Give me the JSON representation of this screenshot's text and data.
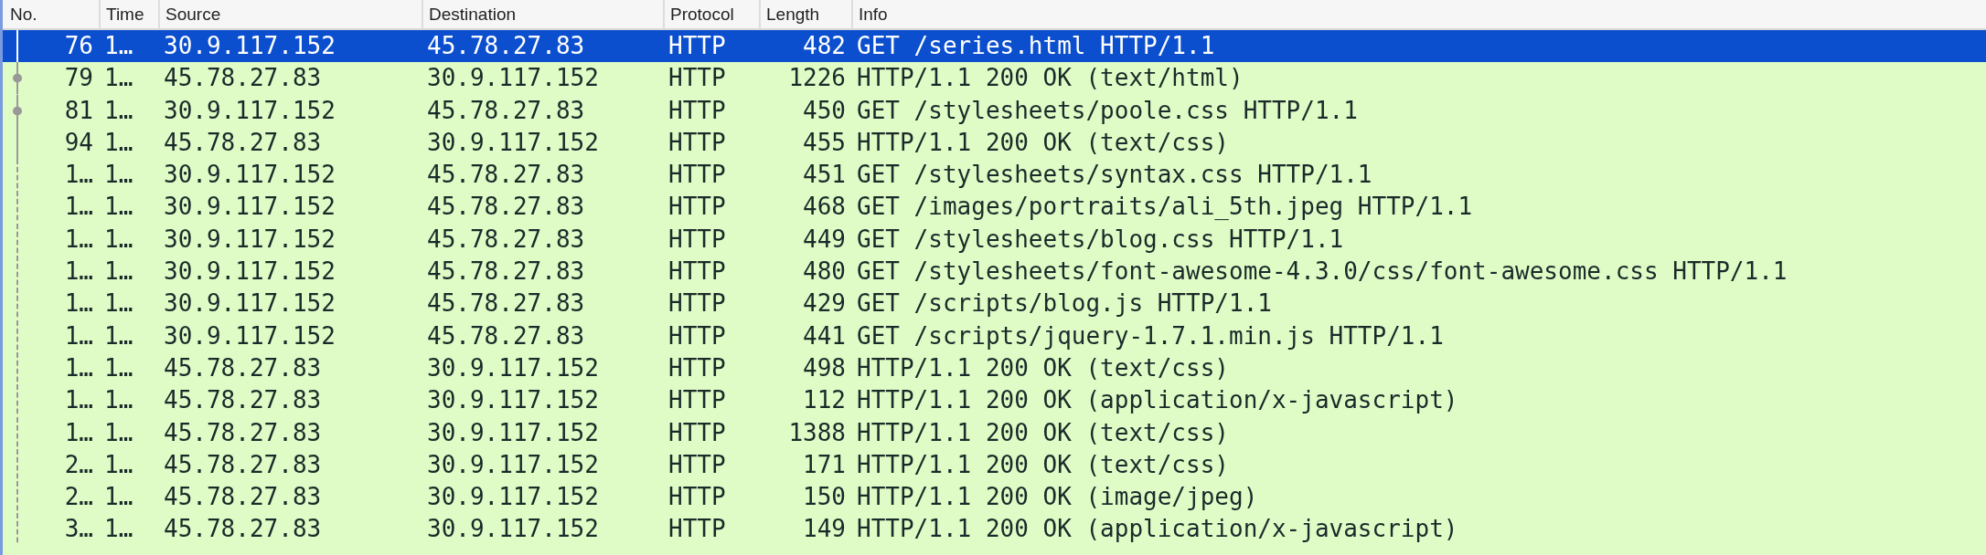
{
  "table": {
    "columns": [
      "No.",
      "Time",
      "Source",
      "Destination",
      "Protocol",
      "Length",
      "Info"
    ],
    "rows": [
      {
        "no": "76",
        "time": "1…",
        "source": "30.9.117.152",
        "destination": "45.78.27.83",
        "protocol": "HTTP",
        "length": "482",
        "info": "GET /series.html HTTP/1.1",
        "selected": true,
        "kind": "start"
      },
      {
        "no": "79",
        "time": "1…",
        "source": "45.78.27.83",
        "destination": "30.9.117.152",
        "protocol": "HTTP",
        "length": "1226",
        "info": "HTTP/1.1 200 OK  (text/html)",
        "selected": false,
        "kind": "dot"
      },
      {
        "no": "81",
        "time": "1…",
        "source": "30.9.117.152",
        "destination": "45.78.27.83",
        "protocol": "HTTP",
        "length": "450",
        "info": "GET /stylesheets/poole.css HTTP/1.1",
        "selected": false,
        "kind": "dot"
      },
      {
        "no": "94",
        "time": "1…",
        "source": "45.78.27.83",
        "destination": "30.9.117.152",
        "protocol": "HTTP",
        "length": "455",
        "info": "HTTP/1.1 200 OK  (text/css)",
        "selected": false,
        "kind": "line"
      },
      {
        "no": "1…",
        "time": "1…",
        "source": "30.9.117.152",
        "destination": "45.78.27.83",
        "protocol": "HTTP",
        "length": "451",
        "info": "GET /stylesheets/syntax.css HTTP/1.1",
        "selected": false,
        "kind": "dashed"
      },
      {
        "no": "1…",
        "time": "1…",
        "source": "30.9.117.152",
        "destination": "45.78.27.83",
        "protocol": "HTTP",
        "length": "468",
        "info": "GET /images/portraits/ali_5th.jpeg HTTP/1.1",
        "selected": false,
        "kind": "dashed"
      },
      {
        "no": "1…",
        "time": "1…",
        "source": "30.9.117.152",
        "destination": "45.78.27.83",
        "protocol": "HTTP",
        "length": "449",
        "info": "GET /stylesheets/blog.css HTTP/1.1",
        "selected": false,
        "kind": "dashed"
      },
      {
        "no": "1…",
        "time": "1…",
        "source": "30.9.117.152",
        "destination": "45.78.27.83",
        "protocol": "HTTP",
        "length": "480",
        "info": "GET /stylesheets/font-awesome-4.3.0/css/font-awesome.css HTTP/1.1",
        "selected": false,
        "kind": "dashed"
      },
      {
        "no": "1…",
        "time": "1…",
        "source": "30.9.117.152",
        "destination": "45.78.27.83",
        "protocol": "HTTP",
        "length": "429",
        "info": "GET /scripts/blog.js HTTP/1.1",
        "selected": false,
        "kind": "dashed"
      },
      {
        "no": "1…",
        "time": "1…",
        "source": "30.9.117.152",
        "destination": "45.78.27.83",
        "protocol": "HTTP",
        "length": "441",
        "info": "GET /scripts/jquery-1.7.1.min.js HTTP/1.1",
        "selected": false,
        "kind": "dashed"
      },
      {
        "no": "1…",
        "time": "1…",
        "source": "45.78.27.83",
        "destination": "30.9.117.152",
        "protocol": "HTTP",
        "length": "498",
        "info": "HTTP/1.1 200 OK  (text/css)",
        "selected": false,
        "kind": "dashed"
      },
      {
        "no": "1…",
        "time": "1…",
        "source": "45.78.27.83",
        "destination": "30.9.117.152",
        "protocol": "HTTP",
        "length": "112",
        "info": "HTTP/1.1 200 OK  (application/x-javascript)",
        "selected": false,
        "kind": "dashed"
      },
      {
        "no": "1…",
        "time": "1…",
        "source": "45.78.27.83",
        "destination": "30.9.117.152",
        "protocol": "HTTP",
        "length": "1388",
        "info": "HTTP/1.1 200 OK  (text/css)",
        "selected": false,
        "kind": "dashed"
      },
      {
        "no": "2…",
        "time": "1…",
        "source": "45.78.27.83",
        "destination": "30.9.117.152",
        "protocol": "HTTP",
        "length": "171",
        "info": "HTTP/1.1 200 OK  (text/css)",
        "selected": false,
        "kind": "dashed"
      },
      {
        "no": "2…",
        "time": "1…",
        "source": "45.78.27.83",
        "destination": "30.9.117.152",
        "protocol": "HTTP",
        "length": "150",
        "info": "HTTP/1.1 200 OK  (image/jpeg)",
        "selected": false,
        "kind": "dashed"
      },
      {
        "no": "3…",
        "time": "1…",
        "source": "45.78.27.83",
        "destination": "30.9.117.152",
        "protocol": "HTTP",
        "length": "149",
        "info": "HTTP/1.1 200 OK  (application/x-javascript)",
        "selected": false,
        "kind": "dashed"
      }
    ]
  }
}
